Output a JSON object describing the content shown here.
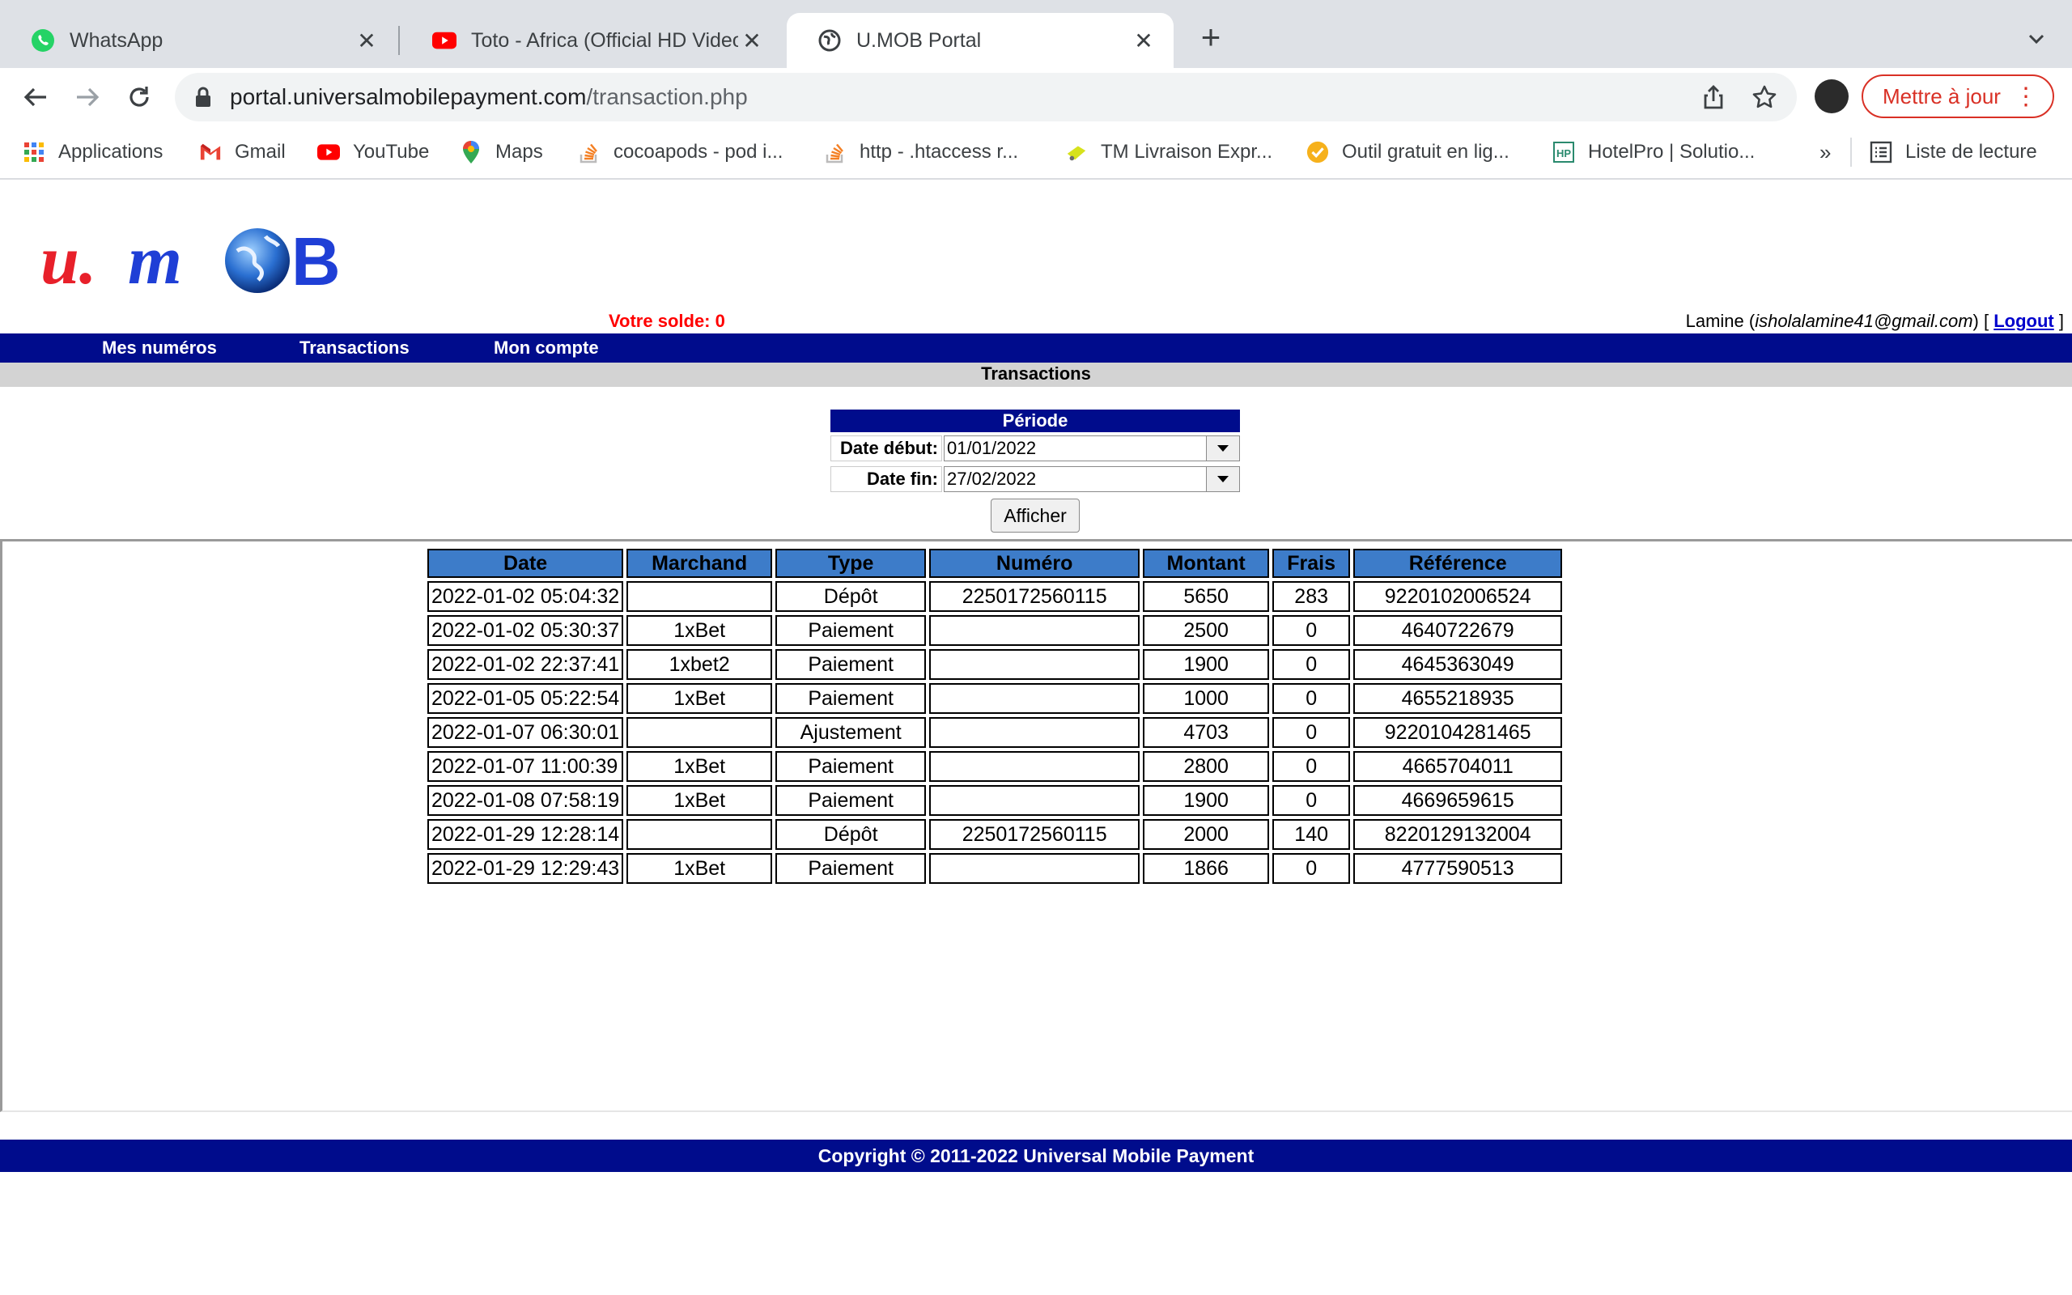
{
  "browser": {
    "tabs": [
      {
        "title": "WhatsApp",
        "icon": "whatsapp-icon",
        "active": false
      },
      {
        "title": "Toto - Africa (Official HD Video)",
        "icon": "youtube-icon",
        "active": false
      },
      {
        "title": "U.MOB Portal",
        "icon": "globe-icon",
        "active": true
      }
    ],
    "url_host": "portal.universalmobilepayment.com",
    "url_path": "/transaction.php",
    "update_button": "Mettre à jour",
    "bookmarks": [
      {
        "label": "Applications",
        "icon": "apps-grid-icon"
      },
      {
        "label": "Gmail",
        "icon": "gmail-icon"
      },
      {
        "label": "YouTube",
        "icon": "youtube-icon"
      },
      {
        "label": "Maps",
        "icon": "maps-pin-icon"
      },
      {
        "label": "cocoapods - pod i...",
        "icon": "stackoverflow-icon"
      },
      {
        "label": "http - .htaccess r...",
        "icon": "stackoverflow-icon"
      },
      {
        "label": "TM Livraison Expr...",
        "icon": "delivery-icon"
      },
      {
        "label": "Outil gratuit en lig...",
        "icon": "check-badge-icon"
      },
      {
        "label": "HotelPro | Solutio...",
        "icon": "hotelpro-icon"
      }
    ],
    "more_bookmarks": "»",
    "reading_list": "Liste de lecture"
  },
  "header": {
    "logo_text": "U.MOB",
    "balance": "Votre solde: 0",
    "user_name": "Lamine (",
    "user_email": "isholalamine41@gmail.com",
    "user_suffix": ") [",
    "logout": "Logout",
    "logout_close": " ]"
  },
  "nav": {
    "items": [
      "Mes numéros",
      "Transactions",
      "Mon compte"
    ]
  },
  "page_title": "Transactions",
  "filter": {
    "title": "Période",
    "start_label": "Date début:",
    "start_value": "01/01/2022",
    "end_label": "Date fin:",
    "end_value": "27/02/2022",
    "submit": "Afficher"
  },
  "table": {
    "columns": [
      "Date",
      "Marchand",
      "Type",
      "Numéro",
      "Montant",
      "Frais",
      "Référence"
    ],
    "rows": [
      [
        "2022-01-02 05:04:32",
        "",
        "Dépôt",
        "2250172560115",
        "5650",
        "283",
        "9220102006524"
      ],
      [
        "2022-01-02 05:30:37",
        "1xBet",
        "Paiement",
        "",
        "2500",
        "0",
        "4640722679"
      ],
      [
        "2022-01-02 22:37:41",
        "1xbet2",
        "Paiement",
        "",
        "1900",
        "0",
        "4645363049"
      ],
      [
        "2022-01-05 05:22:54",
        "1xBet",
        "Paiement",
        "",
        "1000",
        "0",
        "4655218935"
      ],
      [
        "2022-01-07 06:30:01",
        "",
        "Ajustement",
        "",
        "4703",
        "0",
        "9220104281465"
      ],
      [
        "2022-01-07 11:00:39",
        "1xBet",
        "Paiement",
        "",
        "2800",
        "0",
        "4665704011"
      ],
      [
        "2022-01-08 07:58:19",
        "1xBet",
        "Paiement",
        "",
        "1900",
        "0",
        "4669659615"
      ],
      [
        "2022-01-29 12:28:14",
        "",
        "Dépôt",
        "2250172560115",
        "2000",
        "140",
        "8220129132004"
      ],
      [
        "2022-01-29 12:29:43",
        "1xBet",
        "Paiement",
        "",
        "1866",
        "0",
        "4777590513"
      ]
    ]
  },
  "footer": "Copyright © 2011-2022 Universal Mobile Payment",
  "colors": {
    "nav_bg": "#000c8c",
    "header_cell": "#3d7cc9",
    "balance": "#ff0000",
    "logo_red": "#e8202a",
    "logo_blue": "#1f3fd6"
  }
}
